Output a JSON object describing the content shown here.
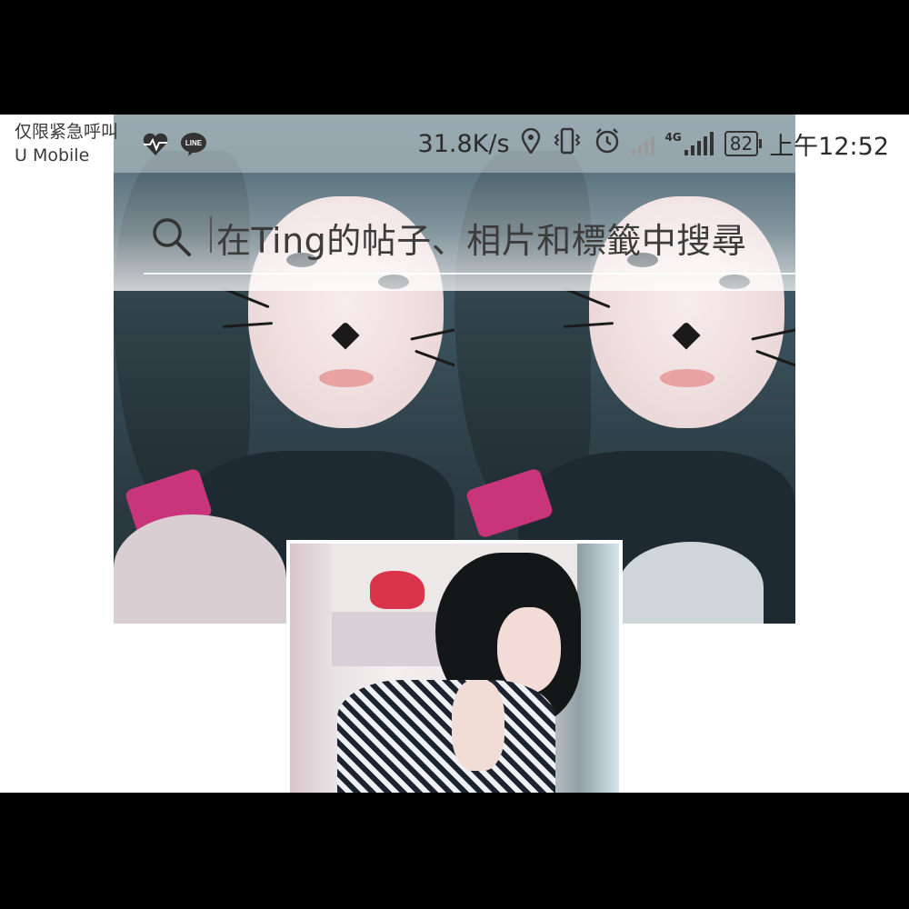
{
  "status_bar": {
    "carrier_notice": "仅限紧急呼叫",
    "carrier_name": "U Mobile",
    "net_speed": "31.8K/s",
    "network_type": "4G",
    "battery_level": "82",
    "time": "上午12:52",
    "icons": [
      "heart-pulse-icon",
      "line-icon",
      "location-icon",
      "vibrate-icon",
      "alarm-icon",
      "no-signal-icon",
      "signal-icon"
    ]
  },
  "search": {
    "placeholder": "在Ting的帖子、相片和標籤中搜尋"
  },
  "photos": [
    {
      "name": "cat-filter-selfie-left"
    },
    {
      "name": "cat-filter-selfie-right"
    },
    {
      "name": "plaid-shirt-selfie"
    }
  ]
}
